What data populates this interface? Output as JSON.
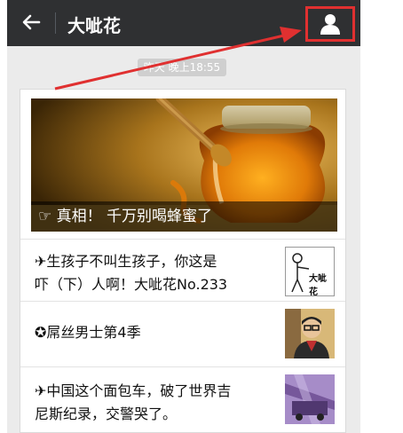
{
  "header": {
    "title": "大呲花",
    "back_icon": "back-arrow-icon",
    "profile_icon": "person-icon"
  },
  "timestamp": "昨天 晚上18:55",
  "cover": {
    "caption": "☞ 真相！ 千万别喝蜂蜜了"
  },
  "articles": [
    {
      "title_line1": "✈生孩子不叫生孩子，你这是",
      "title_line2": "吓（下）人啊！大呲花No.233",
      "thumb_text": "大呲花"
    },
    {
      "title_line1": "✪屌丝男士第4季",
      "title_line2": ""
    },
    {
      "title_line1": "✈中国这个面包车，破了世界吉",
      "title_line2": "尼斯纪录，交警哭了。"
    }
  ],
  "colors": {
    "topbar": "#2f3032",
    "annotation_red": "#e03030"
  }
}
